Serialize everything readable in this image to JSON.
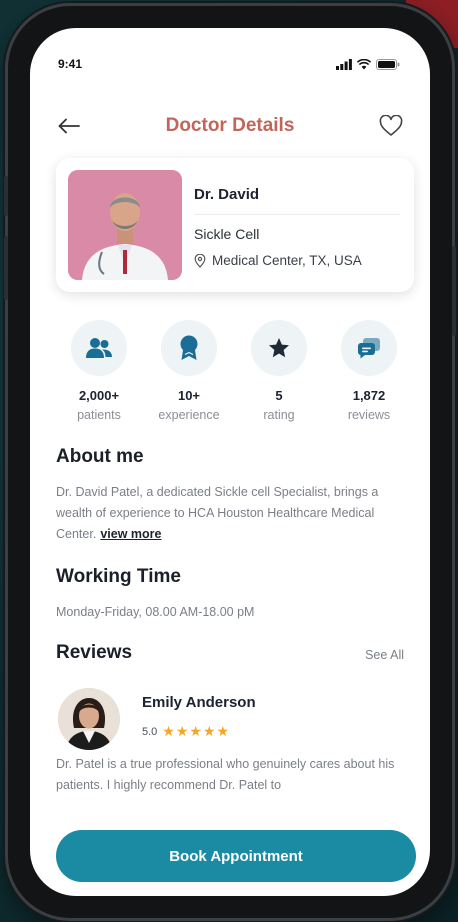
{
  "status_bar": {
    "time": "9:41"
  },
  "nav": {
    "title": "Doctor Details"
  },
  "doctor": {
    "name": "Dr. David",
    "specialty": "Sickle Cell",
    "location": "Medical Center, TX, USA"
  },
  "stats": [
    {
      "value": "2,000+",
      "label": "patients",
      "icon": "patients-icon"
    },
    {
      "value": "10+",
      "label": "experience",
      "icon": "experience-icon"
    },
    {
      "value": "5",
      "label": "rating",
      "icon": "star-icon"
    },
    {
      "value": "1,872",
      "label": "reviews",
      "icon": "reviews-icon"
    }
  ],
  "about": {
    "title": "About me",
    "text": "Dr. David Patel, a dedicated Sickle cell Specialist, brings a wealth of experience to HCA Houston Healthcare Medical Center.",
    "view_more": "view more"
  },
  "working_time": {
    "title": "Working Time",
    "text": "Monday-Friday, 08.00 AM-18.00 pM"
  },
  "reviews": {
    "title": "Reviews",
    "see_all": "See All",
    "items": [
      {
        "name": "Emily Anderson",
        "rating": "5.0",
        "stars": "★★★★★",
        "text": "Dr. Patel is a true professional who genuinely cares about his patients. I highly recommend Dr. Patel to"
      }
    ]
  },
  "cta": {
    "label": "Book Appointment"
  },
  "colors": {
    "accent": "#1a8ba3",
    "title": "#c0665a",
    "star": "#f5a623"
  }
}
